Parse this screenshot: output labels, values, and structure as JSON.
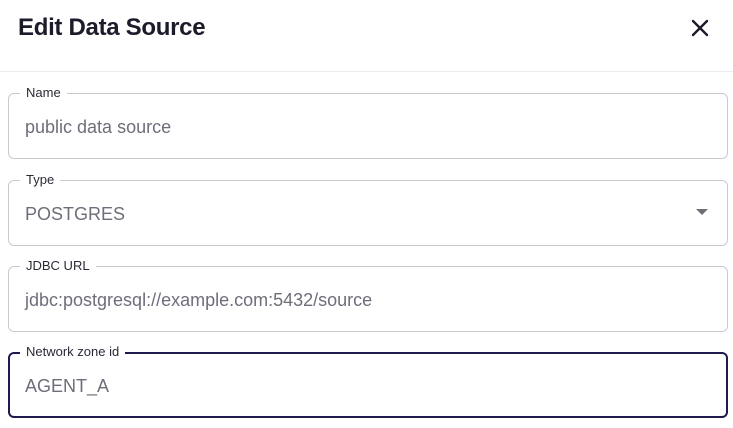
{
  "dialog": {
    "title": "Edit Data Source",
    "close_icon": "close-icon"
  },
  "fields": {
    "name": {
      "label": "Name",
      "value": "public data source"
    },
    "type": {
      "label": "Type",
      "value": "POSTGRES",
      "dropdown_icon": "caret-down-icon"
    },
    "jdbc_url": {
      "label": "JDBC URL",
      "value": "jdbc:postgresql://example.com:5432/source"
    },
    "network_zone": {
      "label": "Network zone id",
      "value": "AGENT_A",
      "focused": true
    }
  },
  "colors": {
    "title": "#1b1b2a",
    "text_muted": "#6e6e7a",
    "border": "#c9c9cf",
    "focus_border": "#1e1a4d"
  }
}
